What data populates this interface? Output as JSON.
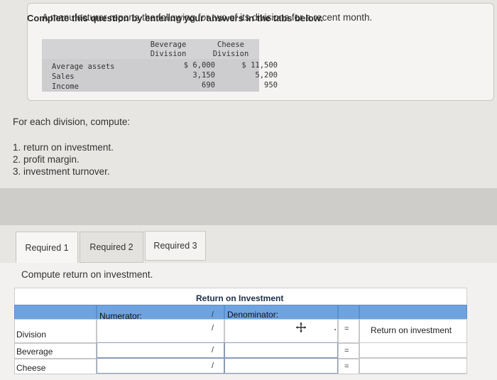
{
  "problem": {
    "statement": "A manufacturer reports the following for two of its divisions for a recent month.",
    "columns": [
      {
        "line1": "Beverage",
        "line2": "Division"
      },
      {
        "line1": "Cheese",
        "line2": "Division"
      }
    ],
    "rows": [
      {
        "label": "Average assets",
        "beverage": "$ 6,000",
        "cheese": "$ 11,500"
      },
      {
        "label": "Sales",
        "beverage": "3,150",
        "cheese": "5,200"
      },
      {
        "label": "Income",
        "beverage": "690",
        "cheese": "950"
      }
    ]
  },
  "instructions": {
    "intro": "For each division, compute:",
    "items": [
      {
        "num": "1.",
        "text": "return on investment."
      },
      {
        "num": "2.",
        "text": "profit margin."
      },
      {
        "num": "3.",
        "text": "investment turnover."
      }
    ]
  },
  "banner": "Complete this question by entering your answers in the tabs below.",
  "tabs": [
    "Required 1",
    "Required 2",
    "Required 3"
  ],
  "active_tab": "Required 1",
  "compute_label": "Compute return on investment.",
  "grid": {
    "title": "Return on Investment",
    "numerator_label": "Numerator:",
    "slash": "/",
    "denominator_label": "Denominator:",
    "equals": "=",
    "result_label": "Return on investment",
    "division_header": "Division",
    "rows": [
      "Beverage",
      "Cheese"
    ]
  }
}
